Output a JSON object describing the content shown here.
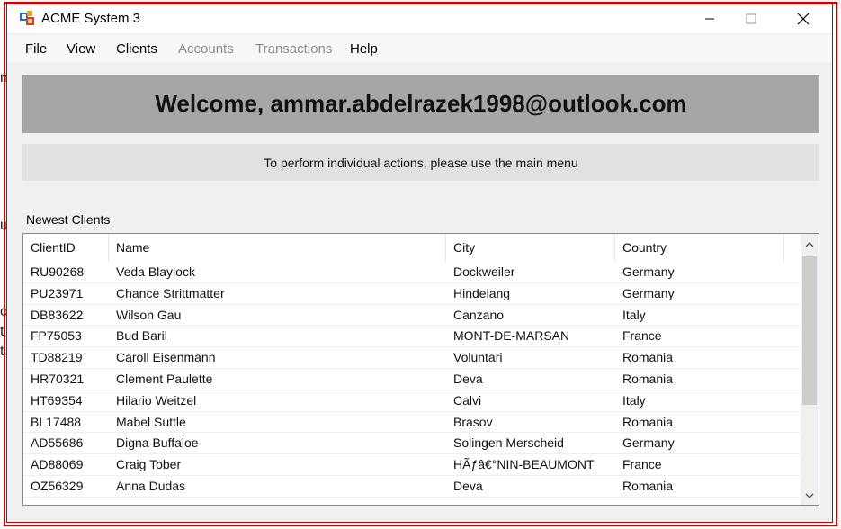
{
  "background_fragments": [
    "n",
    "u",
    "o:",
    "t",
    "t /"
  ],
  "window": {
    "title": "ACME System 3",
    "icon": "app-window-icon",
    "controls": [
      "minimize-icon",
      "maximize-icon",
      "close-icon"
    ]
  },
  "menu": {
    "items": [
      {
        "label": "File",
        "enabled": true
      },
      {
        "label": "View",
        "enabled": true
      },
      {
        "label": "Clients",
        "enabled": true
      },
      {
        "label": "Accounts",
        "enabled": false
      },
      {
        "label": "Transactions",
        "enabled": false
      },
      {
        "label": "Help",
        "enabled": true
      }
    ]
  },
  "welcome": "Welcome, ammar.abdelrazek1998@outlook.com",
  "hint": "To perform individual actions, please use the main menu",
  "newest_clients": {
    "label": "Newest Clients",
    "columns": [
      "ClientID",
      "Name",
      "City",
      "Country"
    ],
    "rows": [
      [
        "RU90268",
        "Veda Blaylock",
        "Dockweiler",
        "Germany"
      ],
      [
        "PU23971",
        "Chance Strittmatter",
        "Hindelang",
        "Germany"
      ],
      [
        "DB83622",
        "Wilson Gau",
        "Canzano",
        "Italy"
      ],
      [
        "FP75053",
        "Bud Baril",
        "MONT-DE-MARSAN",
        "France"
      ],
      [
        "TD88219",
        "Caroll Eisenmann",
        "Voluntari",
        "Romania"
      ],
      [
        "HR70321",
        "Clement Paulette",
        "Deva",
        "Romania"
      ],
      [
        "HT69354",
        "Hilario Weitzel",
        "Calvi",
        "Italy"
      ],
      [
        "BL17488",
        "Mabel Suttle",
        "Brasov",
        "Romania"
      ],
      [
        "AD55686",
        "Digna Buffaloe",
        "Solingen Merscheid",
        "Germany"
      ],
      [
        "AD88069",
        "Craig Tober",
        "HÃƒâ€°NIN-BEAUMONT",
        "France"
      ],
      [
        "OZ56329",
        "Anna Dudas",
        "Deva",
        "Romania"
      ]
    ]
  },
  "colors": {
    "border_accent": "#d00000",
    "welcome_bg": "#a6a6a6",
    "hint_bg": "#e1e1e1",
    "window_bg": "#f0f0f0"
  }
}
